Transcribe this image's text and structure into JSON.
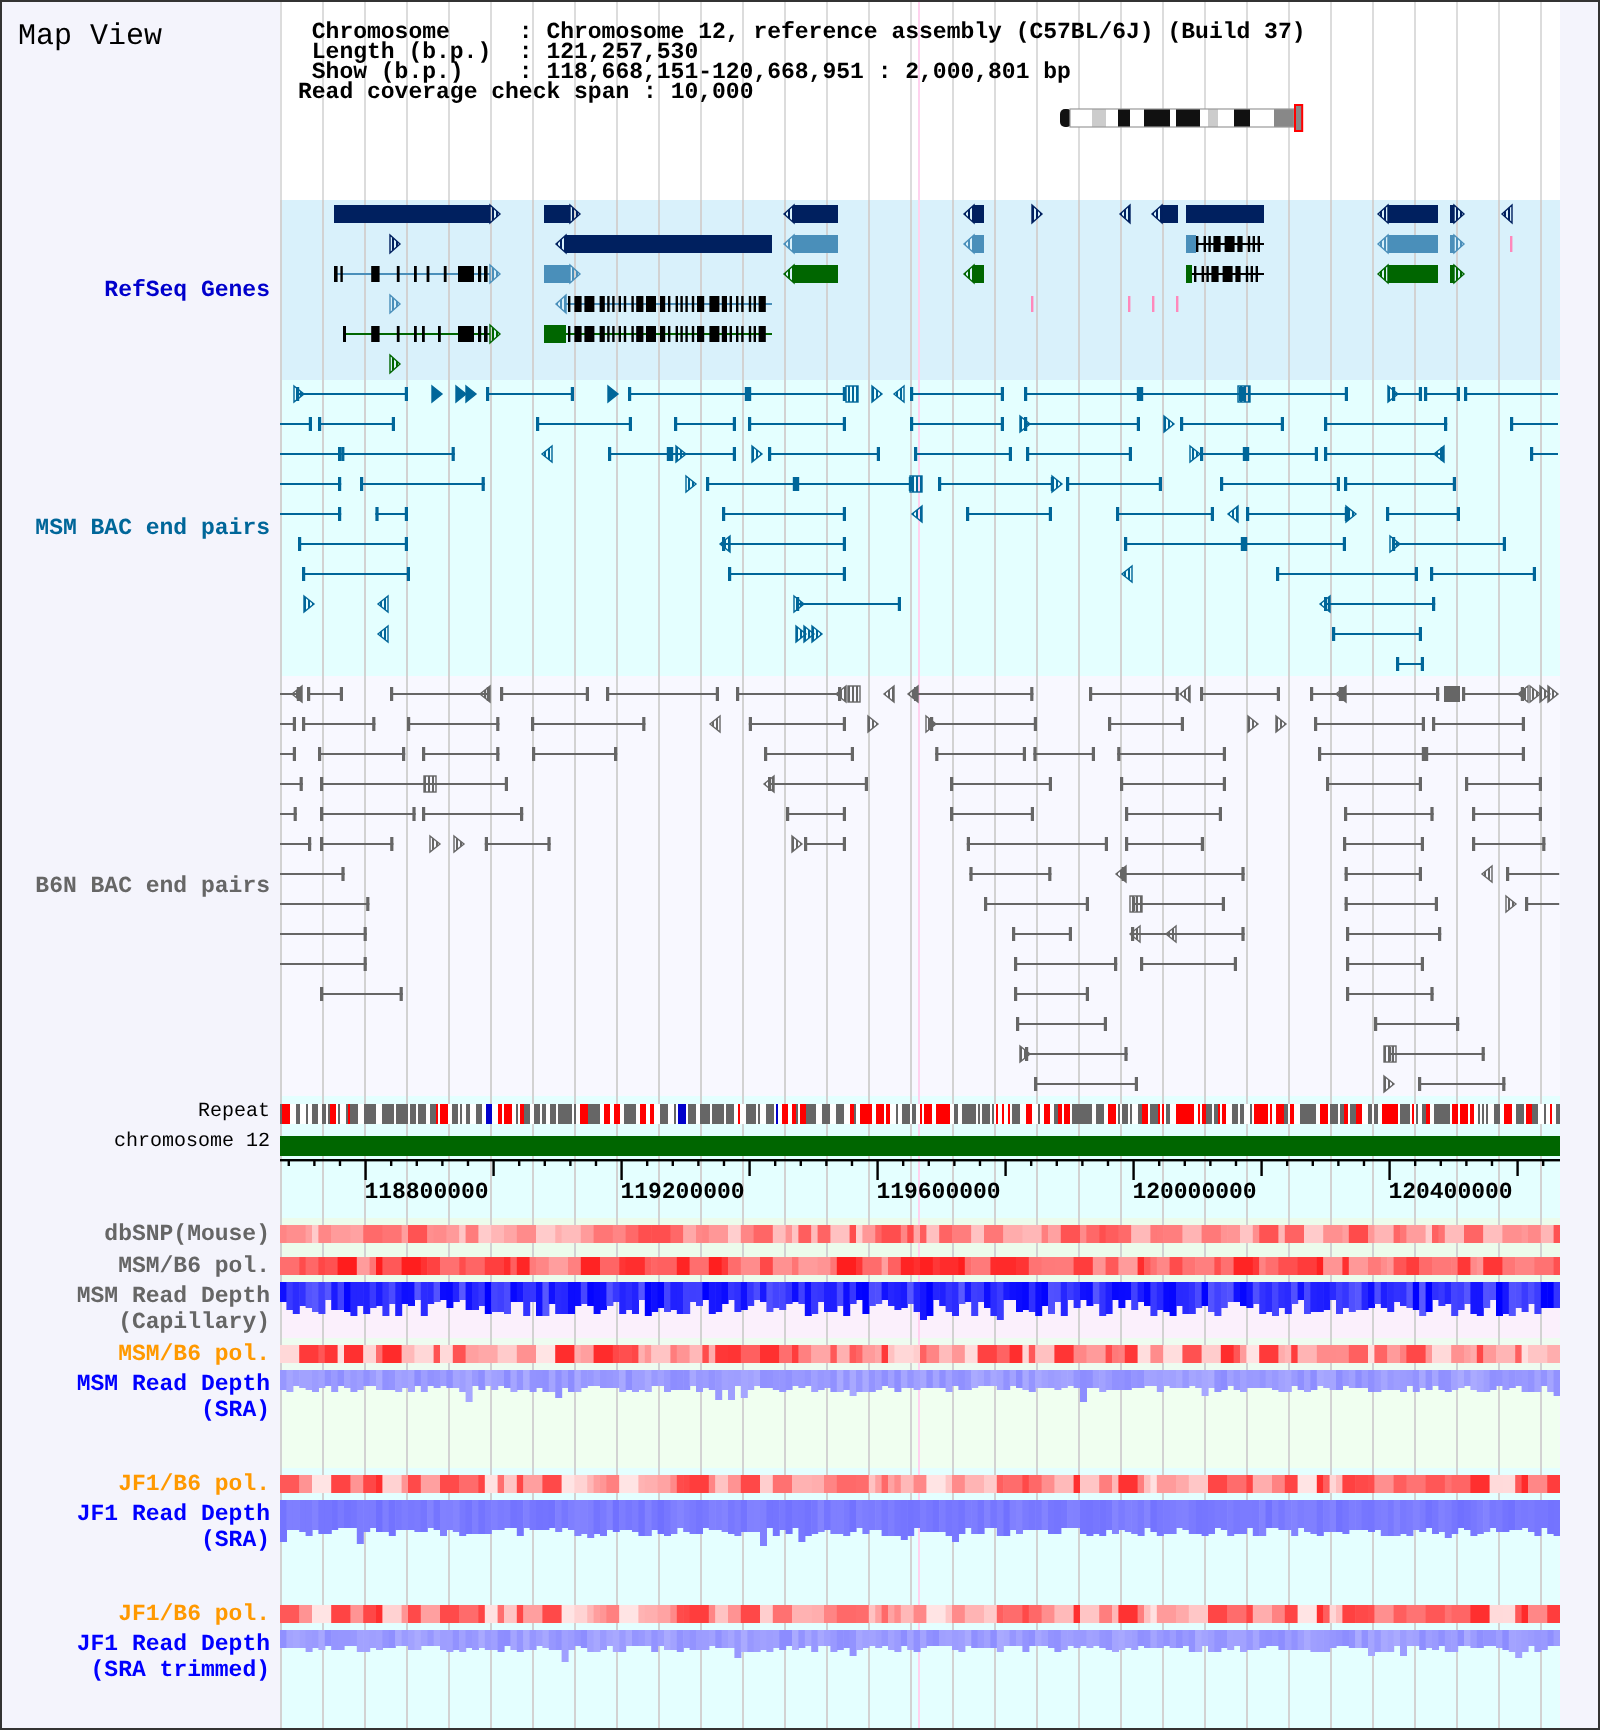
{
  "title": "Map View",
  "header": {
    "rows": [
      {
        "label": "Chromosome",
        "separator": ":",
        "value": "Chromosome 12, reference assembly (C57BL/6J) (Build 37)"
      },
      {
        "label": "Length (b.p.)",
        "separator": ":",
        "value": "121,257,530"
      },
      {
        "label": "Show (b.p.)",
        "separator": ":",
        "value": "118,668,151-120,668,951 : 2,000,801 bp"
      }
    ],
    "coverage_line": "Read coverage check span : 10,000"
  },
  "feature_tracks": [
    {
      "kind": "genes",
      "label": "RefSeq Genes",
      "color": "#0000cc"
    },
    {
      "kind": "bac_pairs",
      "label": "MSM BAC end pairs",
      "color": "#006699"
    },
    {
      "kind": "bac_pairs",
      "label": "B6N BAC end pairs",
      "color": "#666666"
    }
  ],
  "repeat_track": {
    "label": "Repeat"
  },
  "chromosome_track": {
    "label": "chromosome 12"
  },
  "axis": {
    "labels": [
      "118800000",
      "119200000",
      "119600000",
      "120000000",
      "120400000"
    ]
  },
  "data_tracks": [
    {
      "kind": "snp",
      "label": [
        "dbSNP(Mouse)"
      ],
      "color": "#666666"
    },
    {
      "kind": "polymorphism",
      "label": [
        "MSM/B6 pol."
      ],
      "color": "#666666"
    },
    {
      "kind": "depth",
      "label": [
        "MSM Read Depth",
        "(Capillary)"
      ],
      "color": "#666666"
    },
    {
      "kind": "polymorphism",
      "label": [
        "MSM/B6 pol."
      ],
      "color": "#ff9900"
    },
    {
      "kind": "depth",
      "label": [
        "MSM Read Depth",
        "(SRA)"
      ],
      "color": "#0000ff"
    },
    {
      "kind": "polymorphism",
      "label": [
        "JF1/B6 pol."
      ],
      "color": "#ff9900"
    },
    {
      "kind": "depth",
      "label": [
        "JF1 Read Depth",
        "(SRA)"
      ],
      "color": "#0000ff"
    },
    {
      "kind": "polymorphism",
      "label": [
        "JF1/B6 pol."
      ],
      "color": "#ff9900"
    },
    {
      "kind": "depth",
      "label": [
        "JF1 Read Depth",
        "(SRA trimmed)"
      ],
      "color": "#0000ff"
    }
  ]
}
